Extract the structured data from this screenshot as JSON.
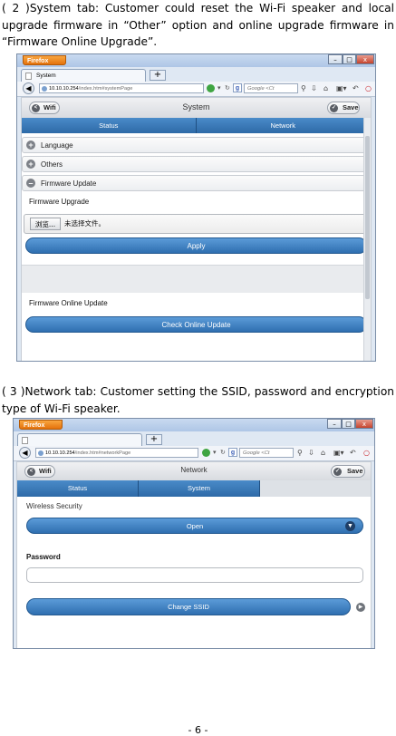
{
  "para1": "( 2 )System tab: Customer could reset the Wi-Fi speaker and local upgrade firmware in “Other” option and online upgrade firmware in “Firmware Online Upgrade”.",
  "para2": "( 3 )Network tab: Customer setting the SSID, password and encryption type of Wi-Fi speaker.",
  "footer": "- 6 -",
  "browser": {
    "menu_button": "Firefox",
    "new_tab": "+",
    "search_engine": "Google",
    "search_placeholder": "Google <Ct",
    "win_min": "–",
    "win_max": "□",
    "win_close": "x"
  },
  "shot1": {
    "tab_title": "System",
    "url_host": "10.10.10.254",
    "url_path": "/index.htm#systemPage",
    "header_title": "System",
    "left_button": "Wifi",
    "right_button": "Save",
    "tabs": [
      "Status",
      "Network"
    ],
    "sections": [
      {
        "label": "Language",
        "state": "+"
      },
      {
        "label": "Others",
        "state": "+"
      },
      {
        "label": "Firmware Update",
        "state": "–"
      }
    ],
    "firmware_upgrade_label": "Firmware Upgrade",
    "browse_button": "浏览...",
    "no_file_text": "未选择文件。",
    "apply_button": "Apply",
    "online_update_label": "Firmware Online Update",
    "check_button": "Check Online Update"
  },
  "shot2": {
    "tab_title": "",
    "url_host": "10.10.10.254",
    "url_path": "/index.htm#networkPage",
    "header_title": "Network",
    "left_button": "Wifi",
    "right_button": "Save",
    "tabs": [
      "Status",
      "System"
    ],
    "wireless_security_label": "Wireless Security",
    "security_value": "Open",
    "password_label": "Password",
    "password_value": "",
    "change_ssid_button": "Change SSID"
  }
}
